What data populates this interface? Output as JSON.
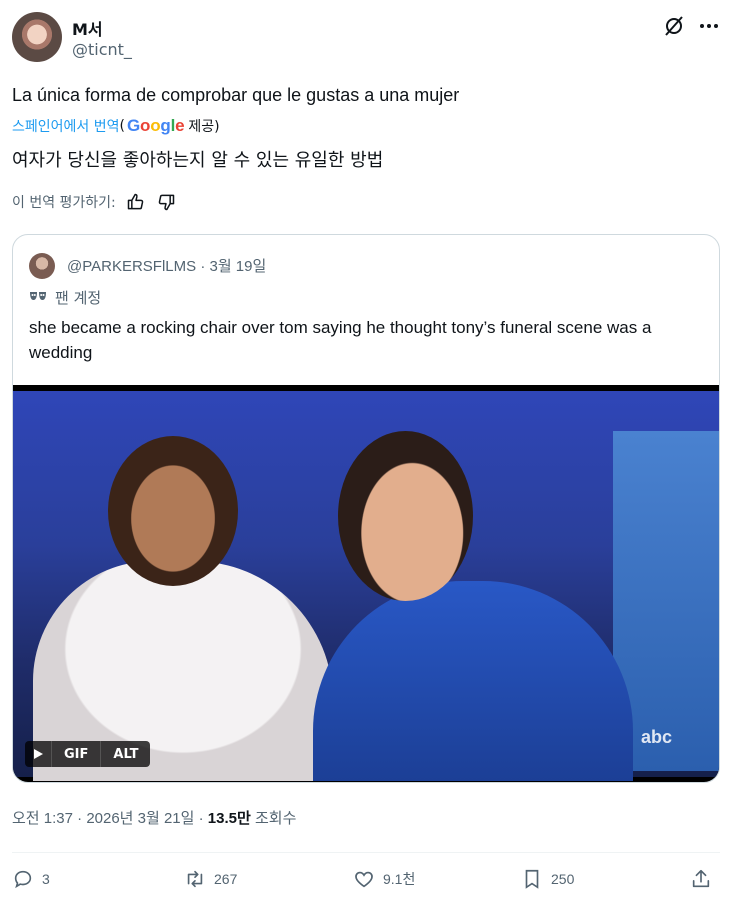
{
  "author": {
    "name": "M서",
    "handle": "@ticnt_"
  },
  "tweet": {
    "text": "La única forma de comprobar que le gustas a una mujer",
    "translated_label": "스페인어에서 번역",
    "open_paren": "(",
    "google_logo_text": "Google",
    "provided_label": "제공)",
    "translated_text": "여자가 당신을 좋아하는지 알 수 있는 유일한 방법",
    "rate_label": "이 번역 평가하기:"
  },
  "quote": {
    "handle": "@PARKERSFlLMS",
    "separator": "·",
    "date": "3월 19일",
    "badge_label": "팬 계정",
    "text": "she became a rocking chair over tom saying he thought tony’s funeral scene was a wedding",
    "media": {
      "gif_label": "GIF",
      "alt_label": "ALT",
      "watermark": "abc"
    }
  },
  "meta": {
    "time": "오전 1:37",
    "sep1": "·",
    "date": "2026년 3월 21일",
    "sep2": "·",
    "views_count": "13.5만",
    "views_label": "조회수"
  },
  "actions": {
    "replies": "3",
    "reposts": "267",
    "likes": "9.1천",
    "bookmarks": "250"
  },
  "icons": [
    "grok-icon",
    "more-icon",
    "thumbs-up-icon",
    "thumbs-down-icon",
    "mask-icon",
    "play-icon",
    "reply-icon",
    "repost-icon",
    "like-icon",
    "bookmark-icon",
    "share-icon"
  ],
  "colors": {
    "link": "#1d9bf0",
    "secondary_text": "#536471",
    "border": "#cfd9de"
  }
}
